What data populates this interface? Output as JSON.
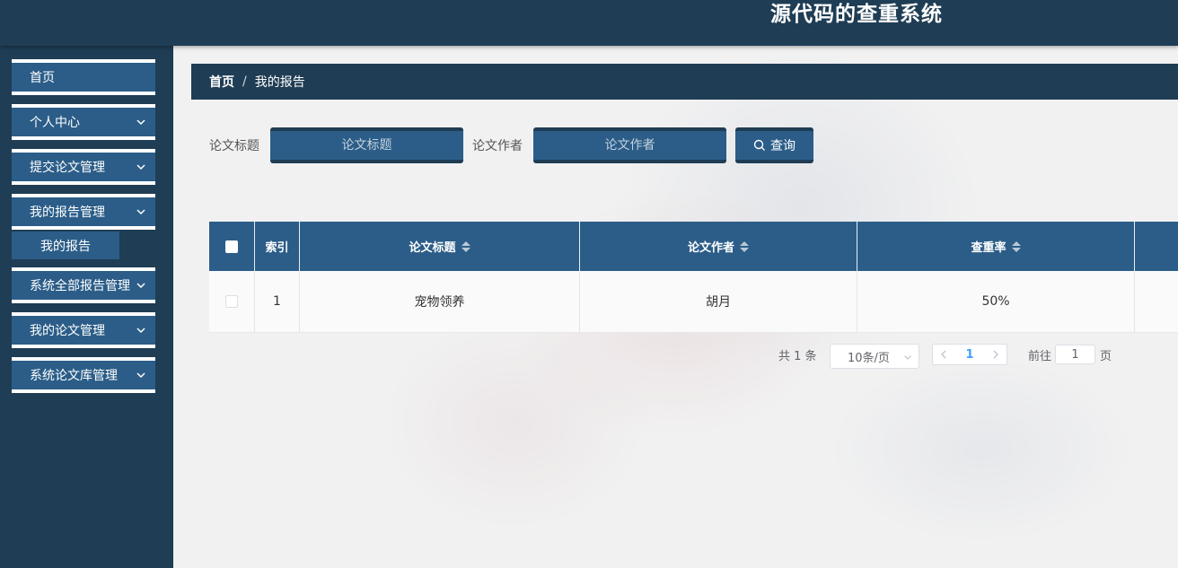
{
  "header": {
    "title": "源代码的查重系统"
  },
  "sidebar": {
    "items": [
      {
        "label": "首页",
        "has_arrow": false
      },
      {
        "label": "个人中心",
        "has_arrow": true
      },
      {
        "label": "提交论文管理",
        "has_arrow": true
      },
      {
        "label": "我的报告管理",
        "has_arrow": true
      },
      {
        "label": "系统全部报告管理",
        "has_arrow": true
      },
      {
        "label": "我的论文管理",
        "has_arrow": true
      },
      {
        "label": "系统论文库管理",
        "has_arrow": true
      }
    ],
    "submenu": {
      "label": "我的报告"
    }
  },
  "breadcrumb": {
    "home": "首页",
    "separator": "/",
    "current": "我的报告"
  },
  "search": {
    "title_label": "论文标题",
    "title_placeholder": "论文标题",
    "author_label": "论文作者",
    "author_placeholder": "论文作者",
    "query_button": "查询"
  },
  "table": {
    "headers": {
      "index": "索引",
      "title": "论文标题",
      "author": "论文作者",
      "rate": "查重率"
    },
    "rows": [
      {
        "index": "1",
        "title": "宠物领养",
        "author": "胡月",
        "rate": "50%"
      }
    ]
  },
  "pagination": {
    "total": "共 1 条",
    "page_size": "10条/页",
    "current_page": "1",
    "goto_label": "前往",
    "goto_value": "1",
    "page_suffix": "页"
  },
  "colors": {
    "header_bg": "#1f3d54",
    "accent": "#2b5d88",
    "active_page": "#409eff"
  }
}
